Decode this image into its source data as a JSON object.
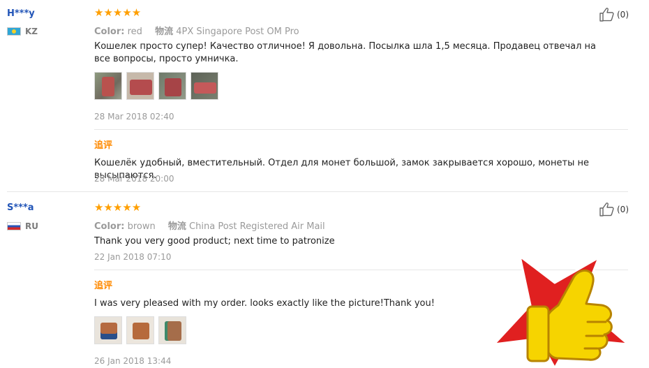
{
  "reviews": [
    {
      "user": "H***y",
      "country": "KZ",
      "stars": "★★★★★",
      "color_label": "Color:",
      "color_value": "red",
      "ship_label": "物流",
      "ship_value": "4PX Singapore Post OM Pro",
      "text": "Кошелек просто супер! Качество отличное! Я довольна. Посылка шла 1,5 месяца. Продавец отвечал на все вопросы, просто умничка.",
      "date": "28 Mar 2018 02:40",
      "likes": "(0)",
      "followup_label": "追评",
      "followup_text": "Кошелёк удобный, вместительный. Отдел для монет большой, замок закрывается хорошо, монеты не высыпаются.",
      "followup_date": "28 Mar 2018 20:00"
    },
    {
      "user": "S***a",
      "country": "RU",
      "stars": "★★★★★",
      "color_label": "Color:",
      "color_value": "brown",
      "ship_label": "物流",
      "ship_value": "China Post Registered Air Mail",
      "text": "Thank you very good product; next time to patronize",
      "date": "22 Jan 2018 07:10",
      "likes": "(0)",
      "followup_label": "追评",
      "followup_text": "I was very pleased with my order. looks exactly like the picture!Thank you!",
      "followup_date": "26 Jan 2018 13:44"
    }
  ],
  "colors": {
    "star": "#ff9f00",
    "username": "#2154b7",
    "followup": "#ff8a00",
    "badge_red": "#e02020",
    "badge_yellow": "#f6d400"
  },
  "icons": {
    "like": "thumb-up-outline-icon",
    "badge": "thumbs-up-star-badge-icon"
  }
}
